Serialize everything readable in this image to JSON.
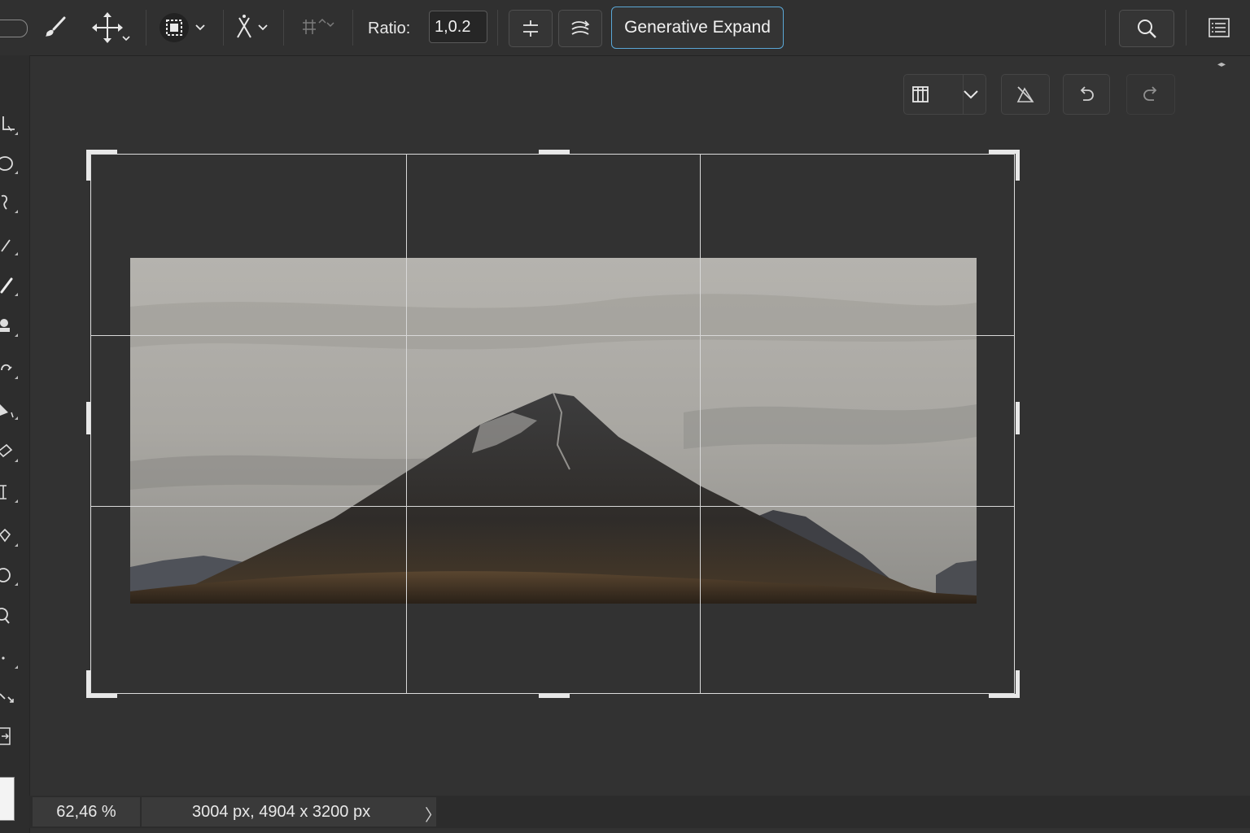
{
  "toolbar": {
    "ratio_label": "Ratio:",
    "ratio_value": "1,0.2",
    "generative_expand_label": "Generative Expand"
  },
  "status": {
    "zoom": "62,46 %",
    "doc_info": "3004 px, 4904 x 3200 px",
    "arrow": "〉"
  },
  "colors": {
    "accent_outline": "#5aa7d6",
    "panel_bg": "#323232"
  },
  "icons": {
    "top": [
      "brush-icon",
      "move-icon",
      "object-select-icon",
      "puppet-icon",
      "grid-tool-icon",
      "straighten-icon",
      "content-aware-icon",
      "search-icon",
      "panels-menu-icon"
    ],
    "canvas_controls": [
      "overlay-grid-icon",
      "chevron-down-icon",
      "clear-crop-icon",
      "undo-icon",
      "redo-icon"
    ]
  }
}
